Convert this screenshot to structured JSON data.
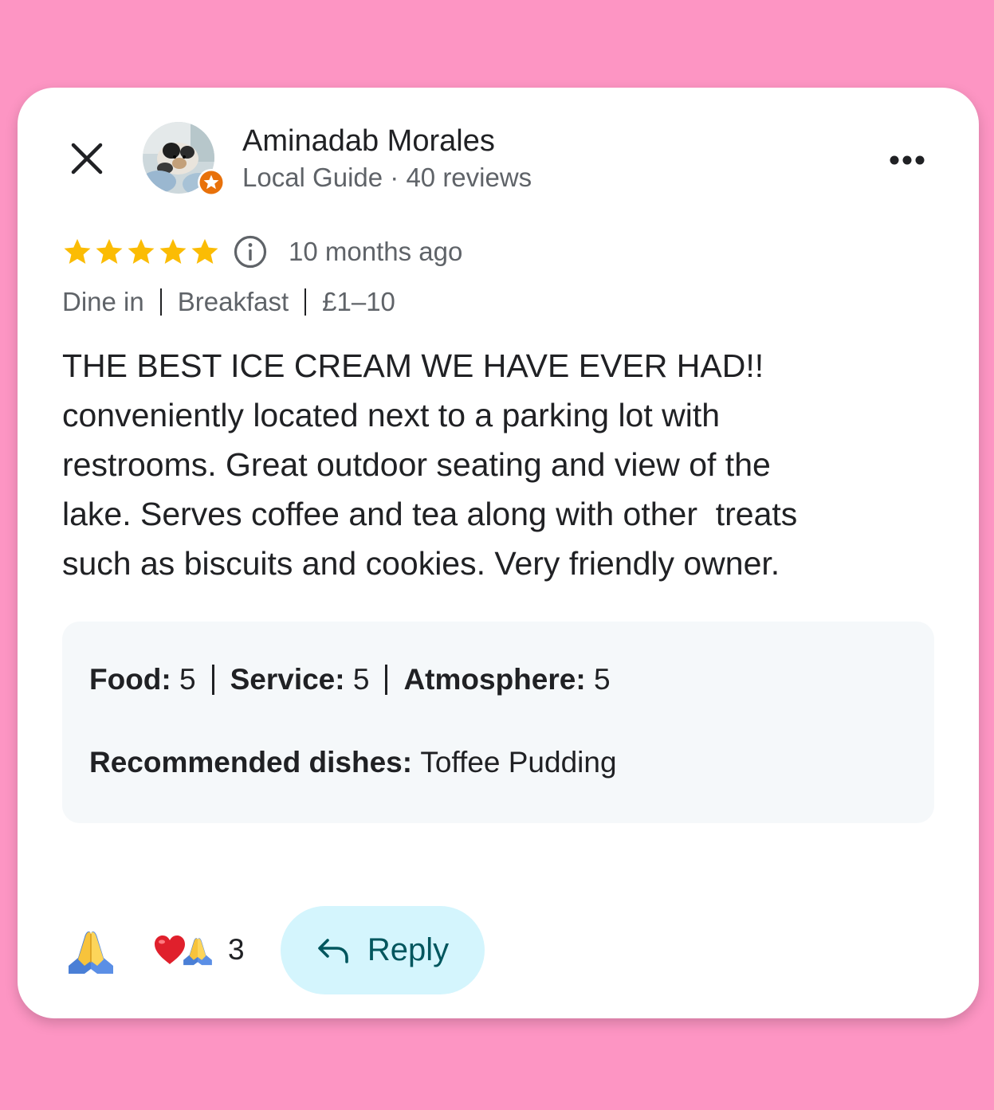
{
  "reviewer": {
    "name": "Aminadab Morales",
    "meta": "Local Guide · 40 reviews"
  },
  "review": {
    "rating": 5,
    "max_rating": 5,
    "time": "10 months ago",
    "tags": [
      "Dine in",
      "Breakfast",
      "£1–10"
    ],
    "text": "THE BEST ICE CREAM WE HAVE EVER HAD!!\nconveniently located next to a parking lot with\nrestrooms. Great outdoor seating and view of the\nlake. Serves coffee and tea along with other  treats\nsuch as biscuits and cookies. Very friendly owner."
  },
  "details": {
    "food_label": "Food:",
    "food_value": "5",
    "service_label": "Service:",
    "service_value": "5",
    "atmosphere_label": "Atmosphere:",
    "atmosphere_value": "5",
    "dishes_label": "Recommended dishes:",
    "dishes_value": "Toffee Pudding"
  },
  "actions": {
    "reaction_count": "3",
    "reply_label": "Reply"
  },
  "colors": {
    "background": "#fd95c3",
    "star": "#fbbc04",
    "badge": "#e8710a",
    "reply_bg": "#d4f5fd",
    "reply_text": "#00565e"
  },
  "icons": [
    "close-icon",
    "local-guide-badge-icon",
    "more-options-icon",
    "star-icon",
    "info-icon",
    "folded-hands-icon",
    "heart-icon",
    "reply-arrow-icon"
  ]
}
